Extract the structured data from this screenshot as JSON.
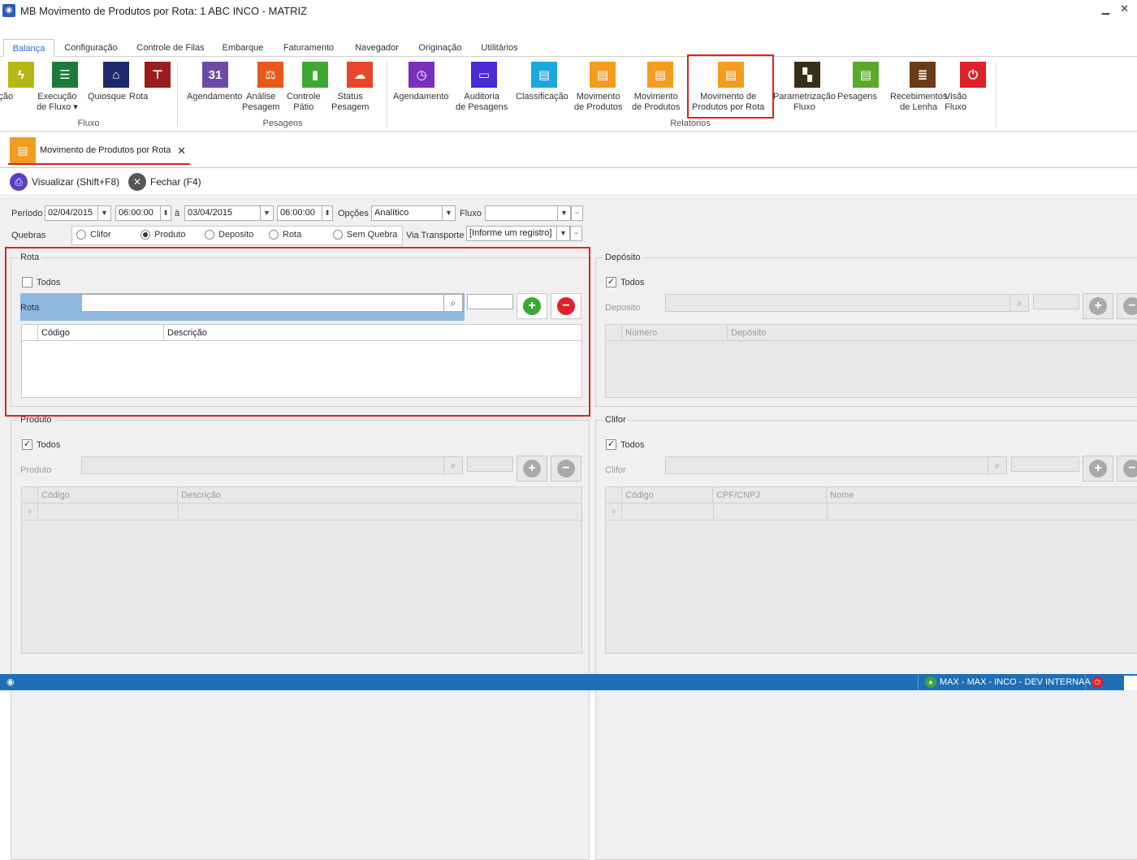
{
  "window": {
    "title": "MB Movimento de Produtos por Rota: 1 ABC INCO - MATRIZ",
    "minimize": "▁",
    "close": "✕"
  },
  "menu_tabs": [
    "Balança",
    "Configuração",
    "Controle de Filas",
    "Embarque",
    "Faturamento",
    "Navegador",
    "Originação",
    "Utilitários"
  ],
  "ribbon": {
    "groups": [
      "Fluxo",
      "Pesagens",
      "Relatorios"
    ],
    "buttons": [
      {
        "label": "Ação",
        "color": "#b5b814",
        "icon": "lightning-icon"
      },
      {
        "label": "Execução\nde Fluxo ▾",
        "color": "#1e7a3a",
        "icon": "list-icon"
      },
      {
        "label": "Quiosque",
        "color": "#1c2a6b",
        "icon": "kiosk-icon"
      },
      {
        "label": "Rota",
        "color": "#9b1c1c",
        "icon": "signpost-icon"
      },
      {
        "label": "Agendamento",
        "color": "#6b4ba5",
        "icon": "calendar-icon"
      },
      {
        "label": "Análise\nPesagem",
        "color": "#e8581a",
        "icon": "gavel-icon"
      },
      {
        "label": "Controle\nPátio",
        "color": "#3ea832",
        "icon": "chart-icon"
      },
      {
        "label": "Status\nPesagem",
        "color": "#e8462a",
        "icon": "cloud-icon"
      },
      {
        "label": "Agendamento",
        "color": "#7b2fbf",
        "icon": "report-clock-icon"
      },
      {
        "label": "Auditoria\nde Pesagens",
        "color": "#4a2ad4",
        "icon": "window-icon"
      },
      {
        "label": "Classificação",
        "color": "#1aa8e0",
        "icon": "doc-icon"
      },
      {
        "label": "Movimento\nde Produtos",
        "color": "#f39c1f",
        "icon": "doc-icon"
      },
      {
        "label": "Movimento\nde Produtos",
        "color": "#f39c1f",
        "icon": "doc-icon"
      },
      {
        "label": "Movimento de\nProdutos por Rota",
        "color": "#f39c1f",
        "icon": "doc-icon"
      },
      {
        "label": "Parametrização\nFluxo",
        "color": "#3a2e1a",
        "icon": "checker-icon"
      },
      {
        "label": "Pesagens",
        "color": "#5aaa2a",
        "icon": "doc-gear-icon"
      },
      {
        "label": "Recebimentos\nde Lenha",
        "color": "#6b3a1a",
        "icon": "stack-icon"
      },
      {
        "label": "Visão\nFluxo",
        "color": "#e0202a",
        "icon": "doc-power-icon"
      }
    ]
  },
  "doc_tab": {
    "label": "Movimento de Produtos por Rota",
    "close": "✕"
  },
  "toolbar": {
    "visualizar": "Visualizar (Shift+F8)",
    "fechar": "Fechar (F4)"
  },
  "filters": {
    "periodo_label": "Período",
    "date_from": "02/04/2015",
    "time_from": "06:00:00",
    "ate_label": "à",
    "date_to": "03/04/2015",
    "time_to": "06:00:00",
    "opcoes_label": "Opções",
    "opcoes_value": "Analítico",
    "fluxo_label": "Fluxo",
    "fluxo_value": "",
    "quebras_label": "Quebras",
    "quebras_options": [
      "Clifor",
      "Produto",
      "Deposito",
      "Rota",
      "Sem Quebra"
    ],
    "quebras_selected": 1,
    "via_label": "Via Transporte",
    "via_value": "[Informe um registro]"
  },
  "panels": {
    "rota": {
      "title": "Rota",
      "todos": "Todos",
      "field_label": "Rota",
      "cols": [
        "Código",
        "Descrição"
      ]
    },
    "deposito": {
      "title": "Depósito",
      "todos": "Todos",
      "field_label": "Deposito",
      "cols": [
        "Número",
        "Depósito"
      ]
    },
    "produto": {
      "title": "Produto",
      "todos": "Todos",
      "field_label": "Produto",
      "cols": [
        "Código",
        "Descrição"
      ]
    },
    "clifor": {
      "title": "Clifor",
      "todos": "Todos",
      "field_label": "Clifor",
      "cols": [
        "Código",
        "CPF/CNPJ",
        "Nome"
      ]
    }
  },
  "status": {
    "user": "MAX - MAX - INCO - DEV INTERNAA"
  }
}
